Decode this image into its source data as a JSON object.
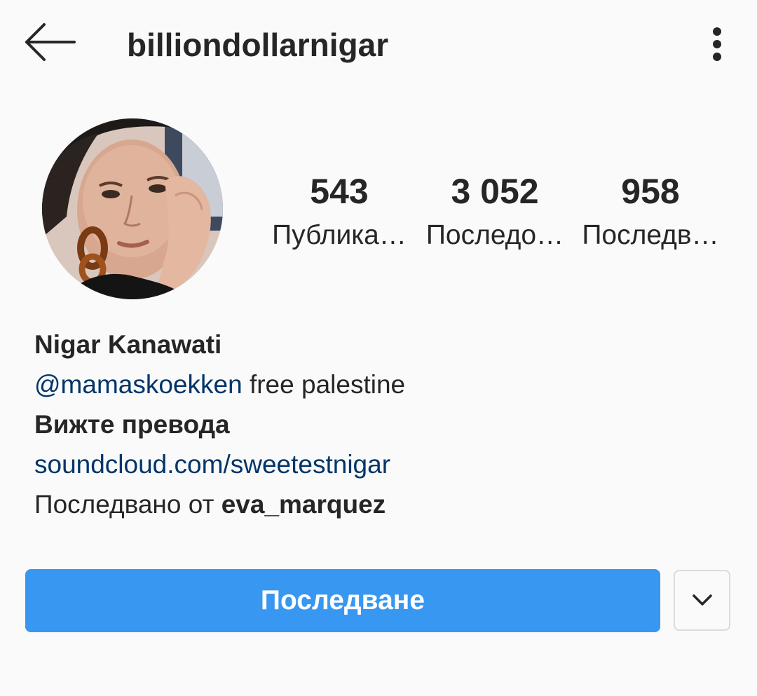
{
  "header": {
    "username": "billiondollarnigar",
    "back_icon": "arrow-left-icon",
    "more_icon": "more-vertical-icon"
  },
  "profile": {
    "avatar_icon": "profile-photo"
  },
  "stats": [
    {
      "value": "543",
      "label": "Публика…"
    },
    {
      "value": "3 052",
      "label": "Последо…"
    },
    {
      "value": "958",
      "label": "Последв…"
    }
  ],
  "bio": {
    "name": "Nigar Kanawati",
    "mention": "@mamaskoekken",
    "text": " free palestine",
    "translate": "Вижте превода",
    "website": "soundcloud.com/sweetestnigar",
    "followed_by_prefix": "Последвано от ",
    "followed_by_user": "eva_marquez"
  },
  "actions": {
    "follow_label": "Последване",
    "dropdown_icon": "chevron-down-icon"
  },
  "colors": {
    "accent": "#3897f0",
    "link": "#003569",
    "background": "#fafafa",
    "text": "#262626"
  }
}
